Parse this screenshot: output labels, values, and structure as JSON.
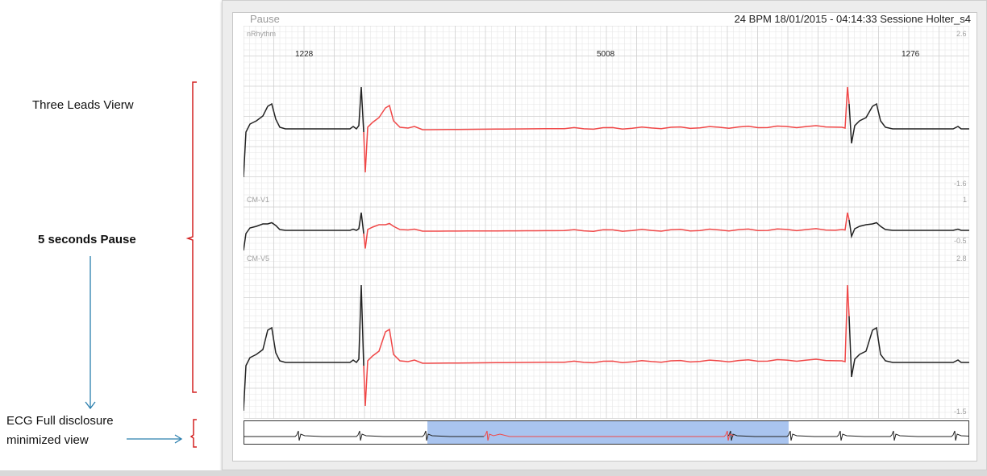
{
  "annotations": {
    "three_leads": "Three Leads Vierw",
    "pause": "5 seconds Pause",
    "ecg_line1": "ECG Full disclosure",
    "ecg_line2": "minimized view"
  },
  "header": {
    "event": "Pause",
    "info": "24 BPM 18/01/2015 - 04:14:33 Sessione Holter_s4"
  },
  "leads": [
    {
      "name": "nRhythm",
      "max": "2.6",
      "min": "-1.6"
    },
    {
      "name": "CM-V1",
      "max": "1",
      "min": "-0.5"
    },
    {
      "name": "CM-V5",
      "max": "2.8",
      "min": "-1.5"
    }
  ],
  "rr_intervals": [
    "1228",
    "5008",
    "1276"
  ],
  "colors": {
    "trace": "#222222",
    "pause_trace": "#f04848",
    "grid_minor": "#e6e6e6",
    "grid_major": "#cfcfcf",
    "bracket": "#d42020",
    "arrow": "#2a7fae",
    "highlight": "#a9c4ef"
  }
}
